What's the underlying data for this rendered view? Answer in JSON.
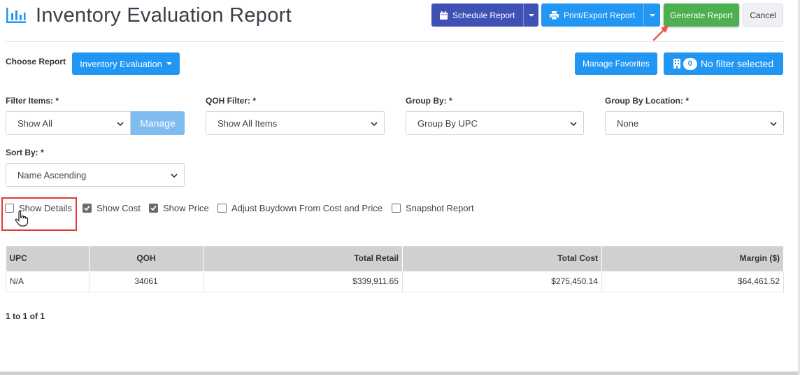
{
  "header": {
    "title": "Inventory Evaluation Report",
    "schedule_label": "Schedule Report",
    "print_label": "Print/Export Report",
    "generate_label": "Generate Report",
    "cancel_label": "Cancel"
  },
  "report_bar": {
    "choose_label": "Choose Report",
    "selected_report": "Inventory Evaluation",
    "favorites_label": "Manage Favorites",
    "filter_count": "0",
    "filter_label": "No filter selected"
  },
  "filters": {
    "filter_items": {
      "label": "Filter Items: *",
      "value": "Show All",
      "manage_label": "Manage"
    },
    "qoh_filter": {
      "label": "QOH Filter: *",
      "value": "Show All Items"
    },
    "group_by": {
      "label": "Group By: *",
      "value": "Group By UPC"
    },
    "group_by_location": {
      "label": "Group By Location: *",
      "value": "None"
    },
    "sort_by": {
      "label": "Sort By: *",
      "value": "Name Ascending"
    }
  },
  "options": [
    {
      "label": "Show Details",
      "checked": false
    },
    {
      "label": "Show Cost",
      "checked": true
    },
    {
      "label": "Show Price",
      "checked": true
    },
    {
      "label": "Adjust Buydown From Cost and Price",
      "checked": false
    },
    {
      "label": "Snapshot Report",
      "checked": false
    }
  ],
  "table": {
    "columns": [
      "UPC",
      "QOH",
      "Total Retail",
      "Total Cost",
      "Margin ($)"
    ],
    "rows": [
      [
        "N/A",
        "34061",
        "$339,911.65",
        "$275,450.14",
        "$64,461.52"
      ]
    ]
  },
  "pagination": "1 to 1 of 1",
  "colors": {
    "schedule": "#3f51b5",
    "primary": "#2196f3",
    "generate": "#4caf50",
    "highlight": "#e53935"
  }
}
